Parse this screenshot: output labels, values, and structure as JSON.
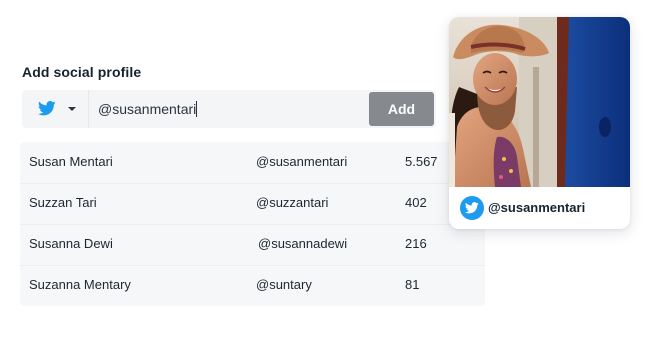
{
  "form": {
    "title": "Add social profile",
    "platform_icon": "twitter-icon",
    "handle_value": "@susanmentari",
    "add_label": "Add"
  },
  "results": [
    {
      "name": "Susan Mentari",
      "handle": "@susanmentari",
      "count": "5.567"
    },
    {
      "name": "Suzzan Tari",
      "handle": "@suzzantari",
      "count": "402"
    },
    {
      "name": "Susanna Dewi",
      "handle": "@susannadewi",
      "count": "216"
    },
    {
      "name": "Suzanna Mentary",
      "handle": "@suntary",
      "count": "81"
    }
  ],
  "preview": {
    "handle": "@susanmentari",
    "badge_icon": "twitter-icon"
  },
  "colors": {
    "twitter_blue": "#1d9bf0",
    "button_gray": "#86898e",
    "panel_bg": "#f4f5f7"
  }
}
